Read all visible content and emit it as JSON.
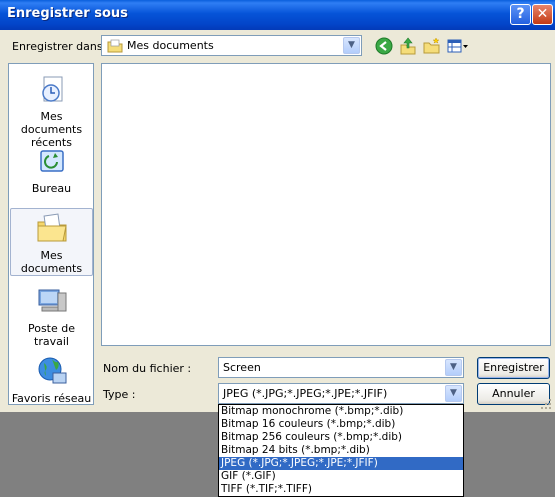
{
  "window": {
    "title": "Enregistrer sous",
    "help_icon": "?",
    "close_icon": "✕"
  },
  "save_in": {
    "label": "Enregistrer dans :",
    "value": "Mes documents",
    "arrow": "▼"
  },
  "toolbar": {
    "back_glyph": "◀",
    "up_glyph": "⬆",
    "new_folder_glyph": "✦",
    "views_glyph": "▦▾"
  },
  "places": [
    {
      "label": "Mes documents récents",
      "icon": "recent-documents-icon"
    },
    {
      "label": "Bureau",
      "icon": "desktop-icon"
    },
    {
      "label": "Mes documents",
      "icon": "my-documents-icon"
    },
    {
      "label": "Poste de travail",
      "icon": "my-computer-icon"
    },
    {
      "label": "Favoris réseau",
      "icon": "network-places-icon"
    }
  ],
  "filename": {
    "label": "Nom du fichier :",
    "value": "Screen",
    "arrow": "▼"
  },
  "filetype": {
    "label": "Type :",
    "value": "JPEG (*.JPG;*.JPEG;*.JPE;*.JFIF)",
    "arrow": "▼"
  },
  "buttons": {
    "save": "Enregistrer",
    "cancel": "Annuler"
  },
  "type_options": [
    "Bitmap monochrome (*.bmp;*.dib)",
    "Bitmap 16 couleurs (*.bmp;*.dib)",
    "Bitmap 256 couleurs (*.bmp;*.dib)",
    "Bitmap 24 bits (*.bmp;*.dib)",
    "JPEG (*.JPG;*.JPEG;*.JPE;*.JFIF)",
    "GIF (*.GIF)",
    "TIFF (*.TIF;*.TIFF)"
  ],
  "type_selected_index": 4,
  "colors": {
    "titlebar": "#0654d8",
    "dialog_bg": "#ece9d8",
    "selection": "#316ac5"
  }
}
